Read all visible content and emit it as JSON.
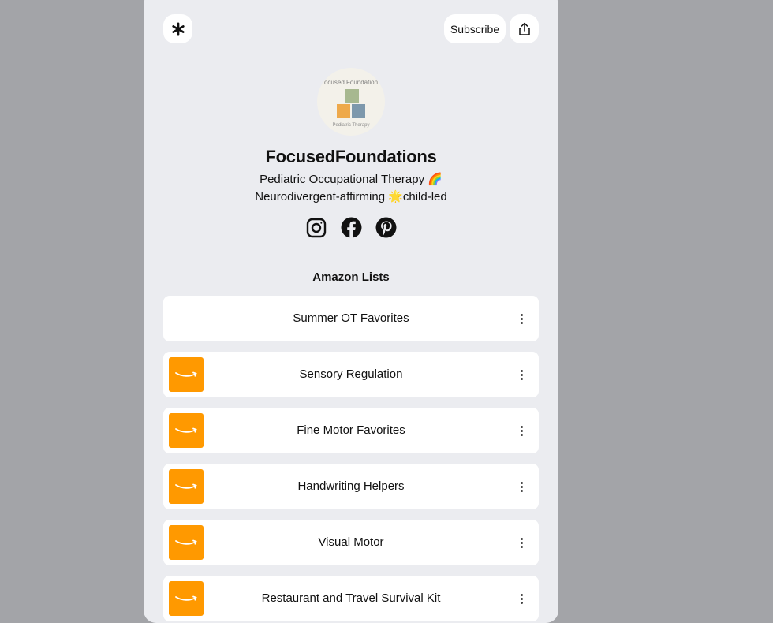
{
  "header": {
    "subscribe_label": "Subscribe"
  },
  "profile": {
    "avatar_text_top": "ocused Foundation",
    "avatar_text_bottom": "Pediatric Therapy",
    "name": "FocusedFoundations",
    "bio_line1": "Pediatric Occupational Therapy 🌈",
    "bio_line2": "Neurodivergent-affirming 🌟child-led"
  },
  "socials": [
    {
      "icon": "instagram-icon"
    },
    {
      "icon": "facebook-icon"
    },
    {
      "icon": "pinterest-icon"
    }
  ],
  "section": {
    "title": "Amazon Lists"
  },
  "links": [
    {
      "label": "Summer OT Favorites",
      "thumb": false
    },
    {
      "label": "Sensory Regulation",
      "thumb": true
    },
    {
      "label": "Fine Motor Favorites",
      "thumb": true
    },
    {
      "label": "Handwriting Helpers",
      "thumb": true
    },
    {
      "label": "Visual Motor",
      "thumb": true
    },
    {
      "label": "Restaurant and Travel Survival Kit",
      "thumb": true
    }
  ],
  "colors": {
    "amazon_orange": "#ff9900",
    "page_bg": "#a3a4a8",
    "card_bg": "#ebecf0"
  }
}
